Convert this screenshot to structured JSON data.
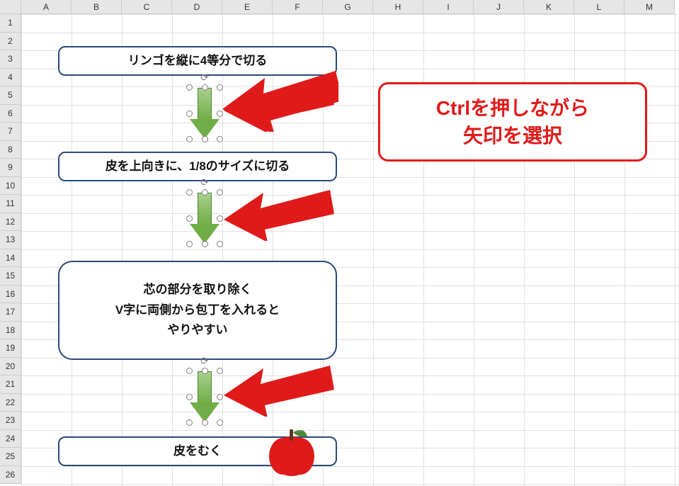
{
  "columns": [
    "A",
    "B",
    "C",
    "D",
    "E",
    "F",
    "G",
    "H",
    "I",
    "J",
    "K",
    "L",
    "M"
  ],
  "rows": [
    "1",
    "2",
    "3",
    "4",
    "5",
    "6",
    "7",
    "8",
    "9",
    "10",
    "11",
    "12",
    "13",
    "14",
    "15",
    "16",
    "17",
    "18",
    "19",
    "20",
    "21",
    "22",
    "23",
    "24",
    "25",
    "26"
  ],
  "flow": {
    "step1": "リンゴを縦に4等分で切る",
    "step2": "皮を上向きに、1/8のサイズに切る",
    "step3_line1": "芯の部分を取り除く",
    "step3_line2": "V字に両側から包丁を入れると",
    "step3_line3": "やりやすい",
    "step4": "皮をむく"
  },
  "callout": {
    "line1": "Ctrlを押しながら",
    "line2": "矢印を選択"
  }
}
